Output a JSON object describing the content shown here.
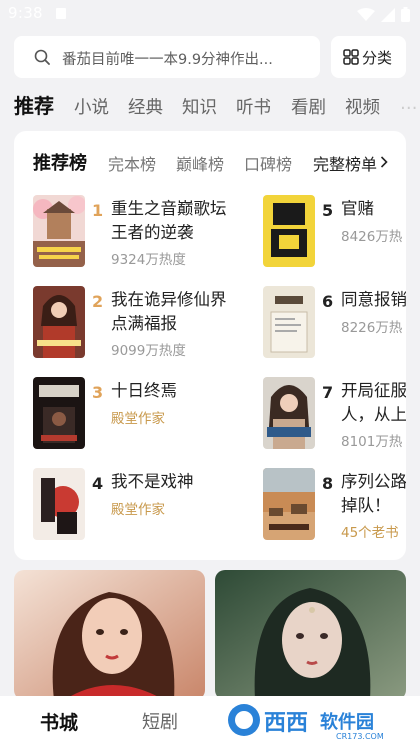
{
  "status_bar": {
    "time": "9:38"
  },
  "search": {
    "placeholder": "番茄目前唯一一本9.9分神作出..."
  },
  "category_button": {
    "label": "分类"
  },
  "channel_tabs": [
    "推荐",
    "小说",
    "经典",
    "知识",
    "听书",
    "看剧",
    "视频"
  ],
  "rank_tabs": [
    "推荐榜",
    "完本榜",
    "巅峰榜",
    "口碑榜"
  ],
  "rank_more": {
    "label": "完整榜单"
  },
  "books": [
    {
      "rank": "1",
      "title": "重生之音巅歌坛\n王者的逆袭",
      "meta": "9324万热度",
      "meta_type": "heat",
      "rank_color": "#e0a35a"
    },
    {
      "rank": "2",
      "title": "我在诡异修仙界\n点满福报",
      "meta": "9099万热度",
      "meta_type": "heat",
      "rank_color": "#e0a35a"
    },
    {
      "rank": "3",
      "title": "十日终焉",
      "meta": "殿堂作家",
      "meta_type": "author",
      "rank_color": "#e0a35a"
    },
    {
      "rank": "4",
      "title": "我不是戏神",
      "meta": "殿堂作家",
      "meta_type": "author",
      "rank_color": "#222222"
    },
    {
      "rank": "5",
      "title": "官赌",
      "meta": "8426万热",
      "meta_type": "heat",
      "rank_color": "#222222"
    },
    {
      "rank": "6",
      "title": "同意报销",
      "meta": "8226万热",
      "meta_type": "heat",
      "rank_color": "#222222"
    },
    {
      "rank": "7",
      "title": "开局征服\n人，从上",
      "meta": "8101万热",
      "meta_type": "heat",
      "rank_color": "#222222"
    },
    {
      "rank": "8",
      "title": "序列公路\n掉队！",
      "meta": "45个老书",
      "meta_type": "author",
      "rank_color": "#222222"
    }
  ],
  "bottom_nav": [
    "书城",
    "短剧"
  ],
  "watermark": {
    "brand": "西西",
    "sub": "软件园",
    "url": "CR173.COM"
  }
}
